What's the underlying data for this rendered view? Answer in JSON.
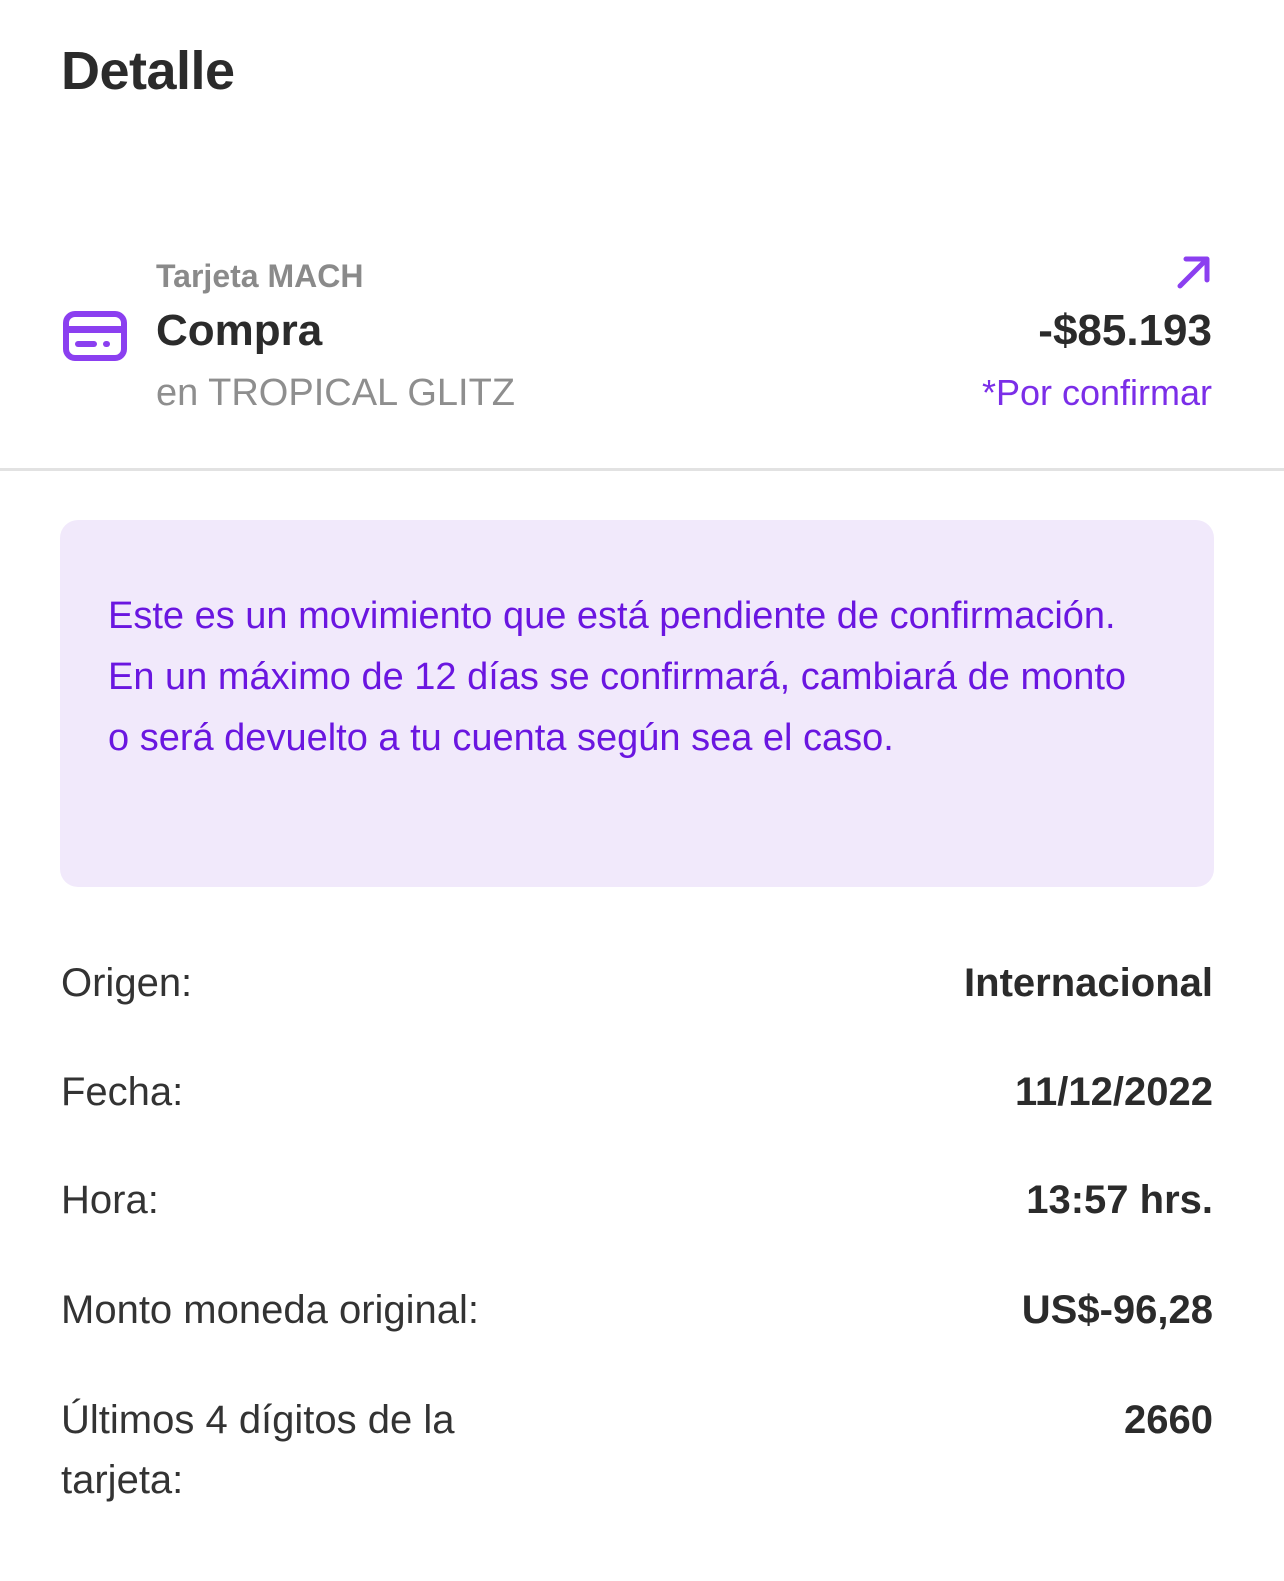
{
  "header": {
    "title": "Detalle"
  },
  "transaction": {
    "source": "Tarjeta MACH",
    "type": "Compra",
    "merchant": "en TROPICAL GLITZ",
    "amount": "-$85.193",
    "status": "*Por confirmar",
    "icon": "credit-card-icon",
    "action_icon": "arrow-up-right-icon"
  },
  "notice": {
    "text": "Este es un movimiento que está pendiente de confirmación. En un máximo de 12 días se confirmará, cambiará de monto o será devuelto a tu cuenta según sea el caso."
  },
  "details": [
    {
      "label": "Origen:",
      "value": "Internacional"
    },
    {
      "label": "Fecha:",
      "value": "11/12/2022"
    },
    {
      "label": "Hora:",
      "value": "13:57 hrs."
    },
    {
      "label": "Monto moneda original:",
      "value": "US$-96,28"
    },
    {
      "label": "Últimos 4 dígitos de la tarjeta:",
      "value": "2660"
    }
  ],
  "colors": {
    "accent": "#7b2ee8",
    "notice_background": "#f1e9fb",
    "notice_text": "#6a16e0",
    "text_primary": "#2b2b2b",
    "text_secondary": "#8a8a8a"
  }
}
